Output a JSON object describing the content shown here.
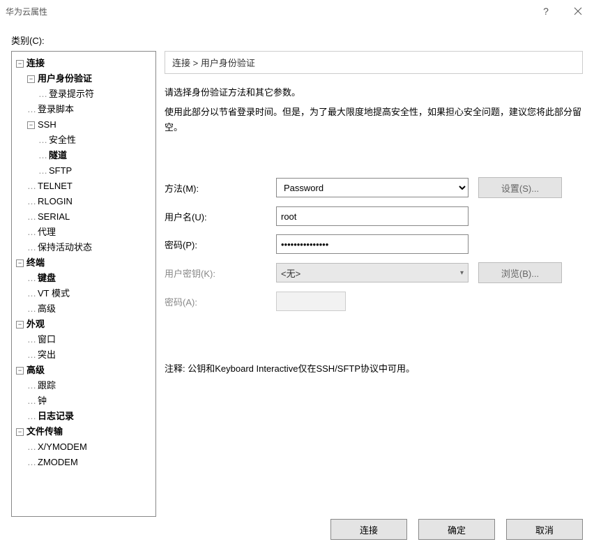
{
  "window": {
    "title": "华为云属性"
  },
  "category_label": "类别(C):",
  "tree": {
    "connection": "连接",
    "user_auth": "用户身份验证",
    "login_prompt": "登录提示符",
    "login_script": "登录脚本",
    "ssh": "SSH",
    "security": "安全性",
    "tunnel": "隧道",
    "sftp": "SFTP",
    "telnet": "TELNET",
    "rlogin": "RLOGIN",
    "serial": "SERIAL",
    "proxy": "代理",
    "keepalive": "保持活动状态",
    "terminal": "终端",
    "keyboard": "键盘",
    "vt_mode": "VT 模式",
    "advanced_term": "高级",
    "appearance": "外观",
    "window": "窗口",
    "highlight": "突出",
    "advanced": "高级",
    "trace": "跟踪",
    "bell": "钟",
    "logging": "日志记录",
    "file_transfer": "文件传输",
    "xymodem": "X/YMODEM",
    "zmodem": "ZMODEM"
  },
  "breadcrumb": "连接 > 用户身份验证",
  "intro": "请选择身份验证方法和其它参数。",
  "desc": "使用此部分以节省登录时间。但是，为了最大限度地提高安全性，如果担心安全问题，建议您将此部分留空。",
  "form": {
    "method_label": "方法(M):",
    "method_value": "Password",
    "method_options": [
      "Password"
    ],
    "settings_btn": "设置(S)...",
    "username_label": "用户名(U):",
    "username_value": "root",
    "password_label": "密码(P):",
    "password_value": "•••••••••••••••",
    "userkey_label": "用户密钥(K):",
    "userkey_value": "<无>",
    "browse_btn": "浏览(B)...",
    "passphrase_label": "密码(A):"
  },
  "note": "注释: 公钥和Keyboard Interactive仅在SSH/SFTP协议中可用。",
  "footer": {
    "connect": "连接",
    "ok": "确定",
    "cancel": "取消"
  }
}
